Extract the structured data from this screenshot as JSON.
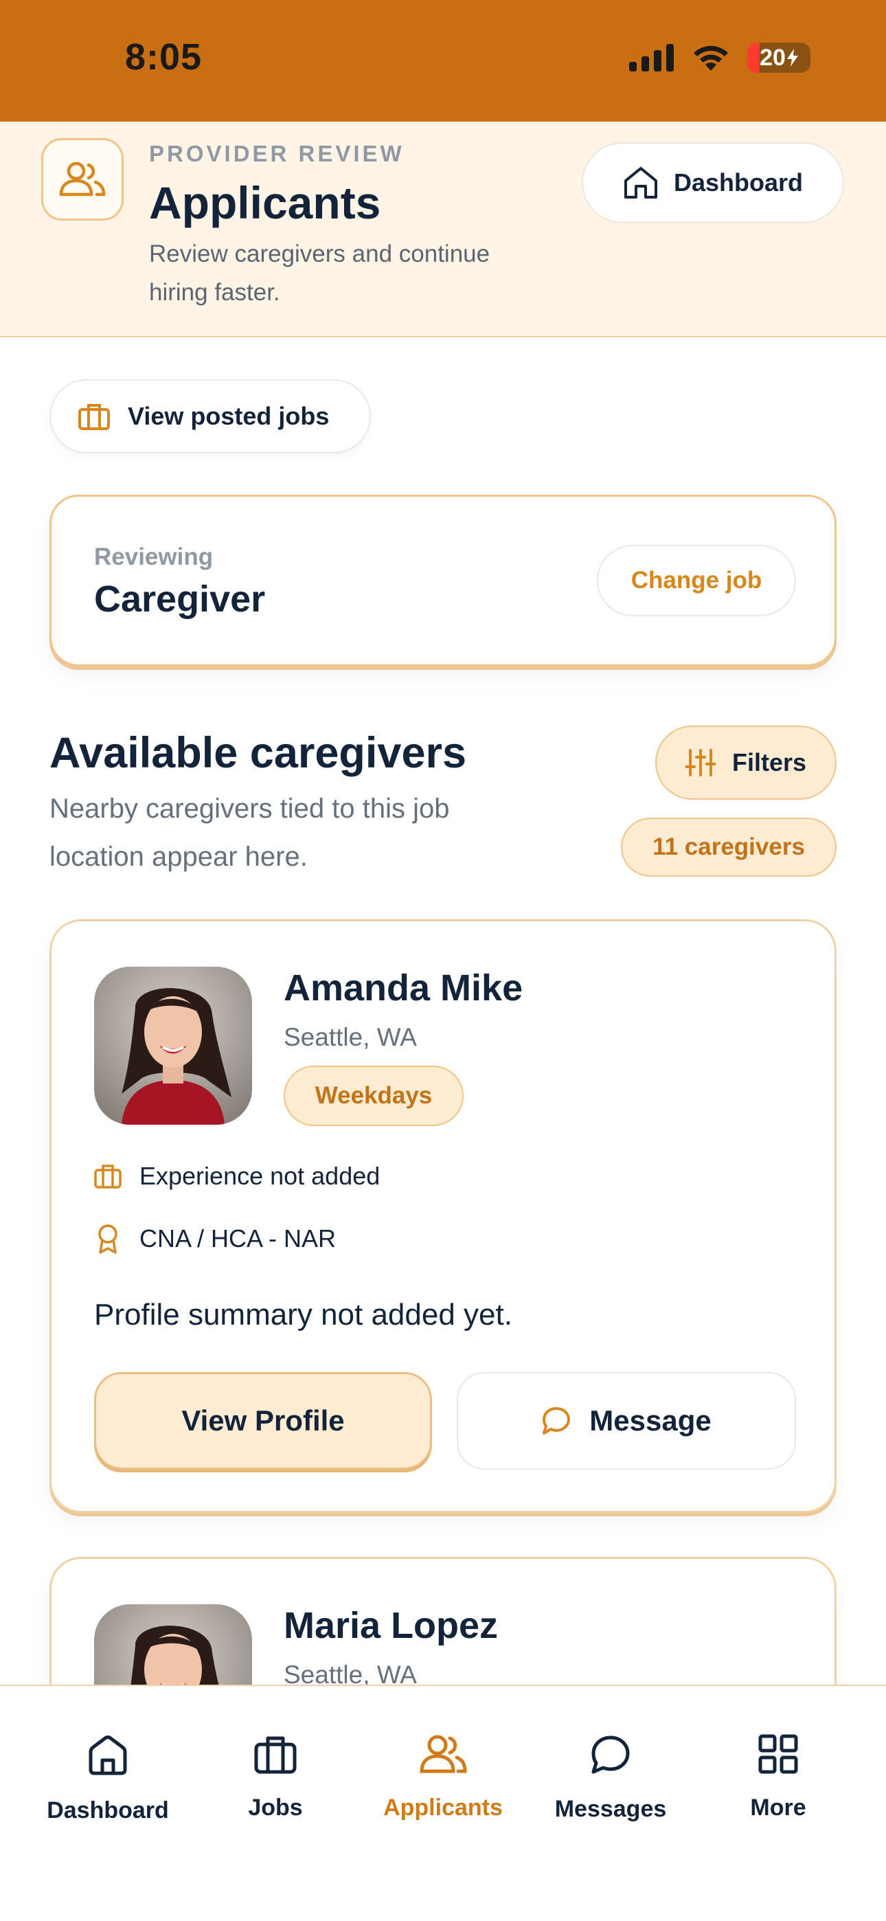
{
  "status_bar": {
    "time": "8:05",
    "battery_level": "20",
    "icons": [
      "cellular-signal-icon",
      "wifi-icon",
      "battery-charging-icon"
    ]
  },
  "header": {
    "eyebrow": "PROVIDER REVIEW",
    "title": "Applicants",
    "subtitle": "Review caregivers and continue hiring faster.",
    "dashboard_label": "Dashboard",
    "icons": [
      "users-icon",
      "home-icon"
    ]
  },
  "posted_jobs": {
    "label": "View posted jobs",
    "icon": "briefcase-icon"
  },
  "reviewing": {
    "label": "Reviewing",
    "job": "Caregiver",
    "change_label": "Change job"
  },
  "section": {
    "title": "Available caregivers",
    "subtitle": "Nearby caregivers tied to this job location appear here.",
    "filters_label": "Filters",
    "filters_icon": "sliders-icon",
    "count_label": "11 caregivers"
  },
  "caregivers": [
    {
      "name": "Amanda Mike",
      "location": "Seattle, WA",
      "availability": "Weekdays",
      "experience": "Experience not added",
      "certification": "CNA / HCA - NAR",
      "summary": "Profile summary not added yet.",
      "view_label": "View Profile",
      "message_label": "Message"
    },
    {
      "name": "Maria Lopez",
      "location": "Seattle, WA"
    }
  ],
  "tabs": [
    {
      "label": "Dashboard",
      "icon": "home-icon",
      "active": false
    },
    {
      "label": "Jobs",
      "icon": "briefcase-icon",
      "active": false
    },
    {
      "label": "Applicants",
      "icon": "users-icon",
      "active": true
    },
    {
      "label": "Messages",
      "icon": "chat-bubble-icon",
      "active": false
    },
    {
      "label": "More",
      "icon": "grid-icon",
      "active": false
    }
  ],
  "colors": {
    "brand": "#c96e12",
    "accent": "#d9861d",
    "accent_soft": "#fdebd2",
    "ink": "#13243a"
  }
}
